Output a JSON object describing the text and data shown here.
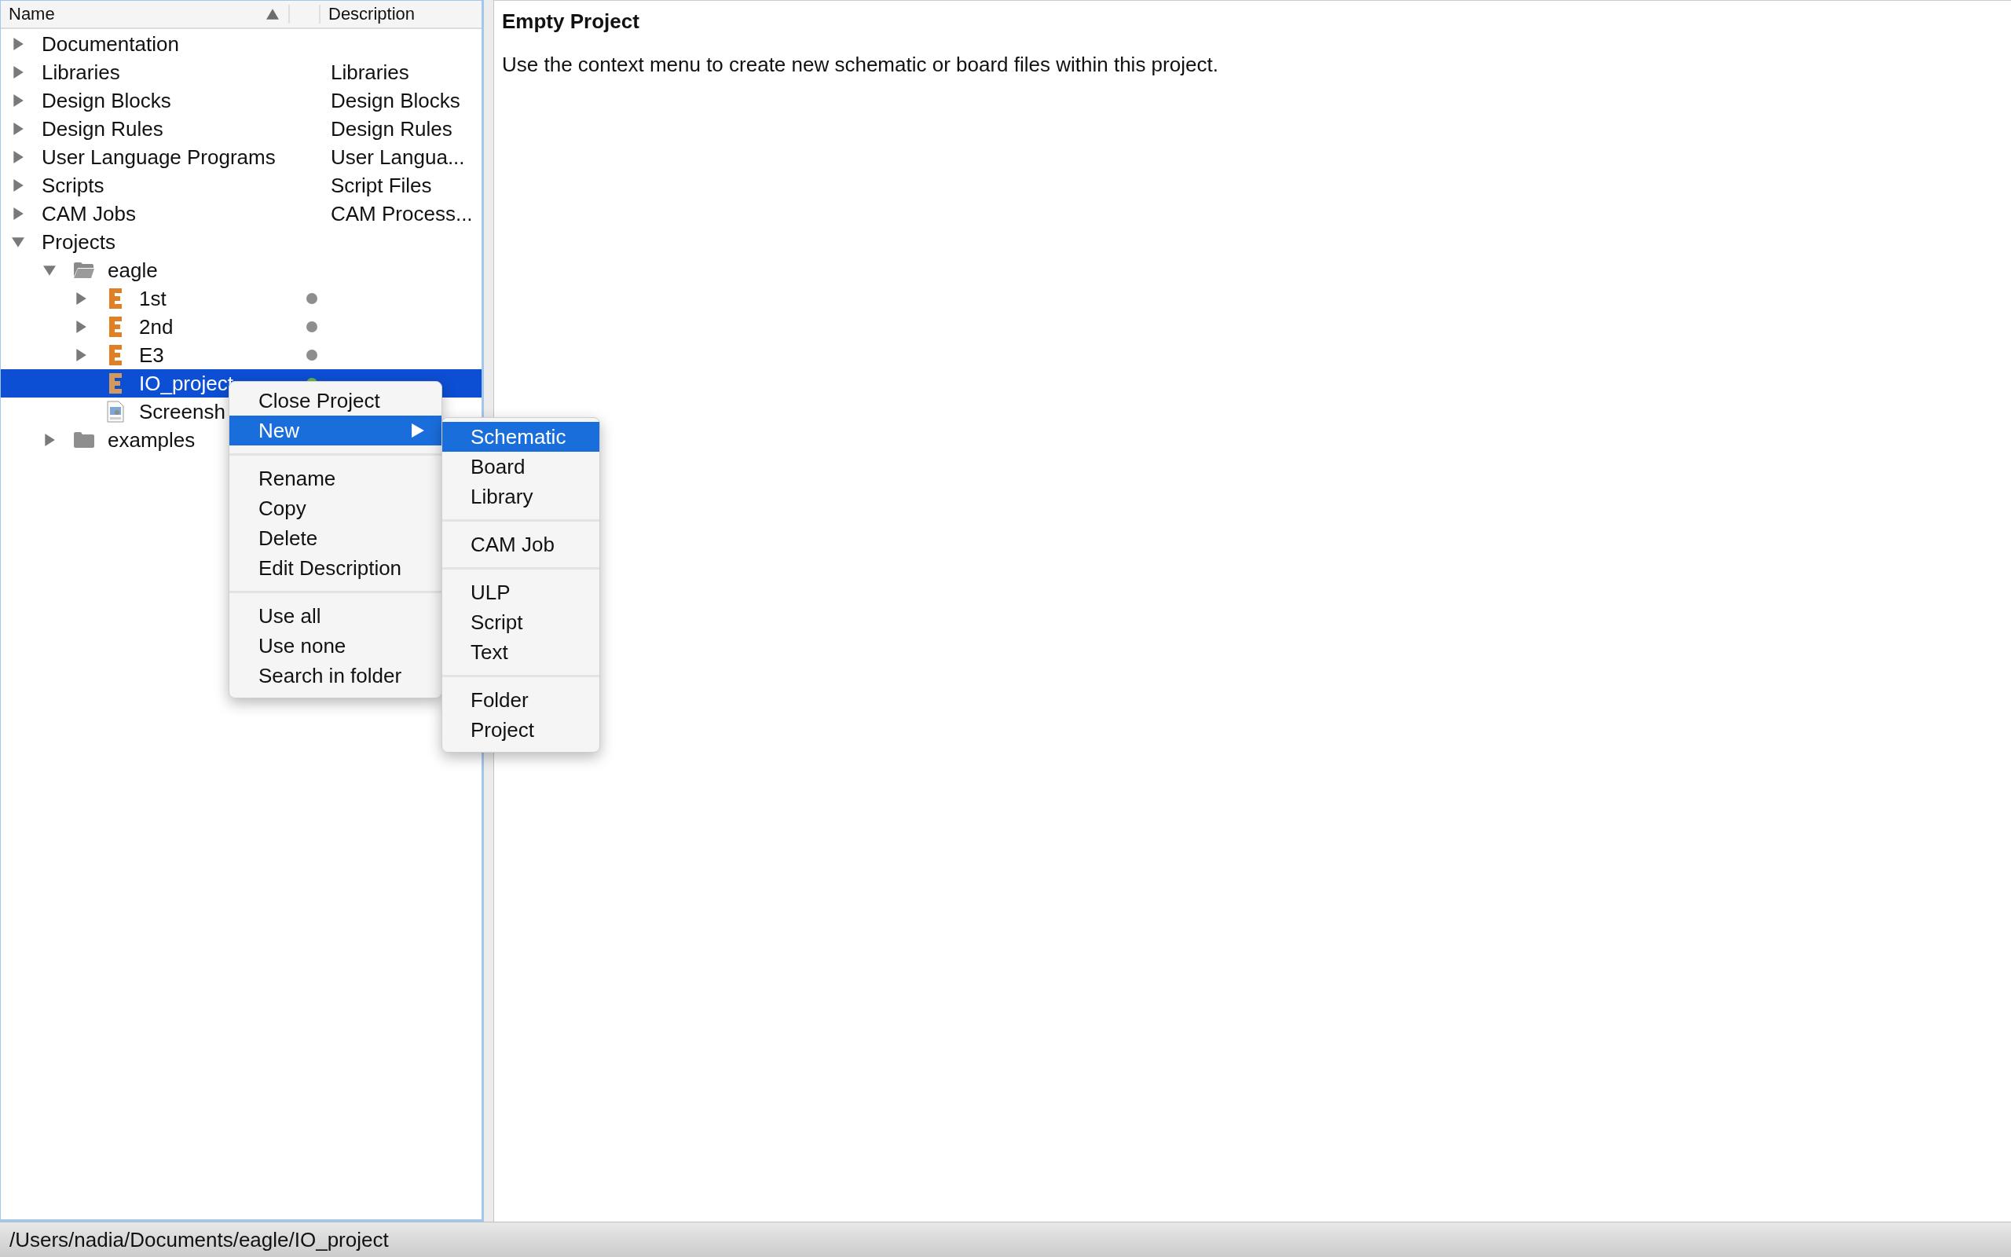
{
  "tree": {
    "columns": [
      {
        "label": "Name",
        "sorted": true
      },
      {
        "label": "Description"
      }
    ],
    "items": [
      {
        "name": "Documentation",
        "expanded": false,
        "selected": false
      },
      {
        "name": "Libraries",
        "description": "Libraries",
        "expanded": false,
        "selected": false
      },
      {
        "name": "Design Blocks",
        "description": "Design Blocks",
        "expanded": false,
        "selected": false
      },
      {
        "name": "Design Rules",
        "description": "Design Rules",
        "expanded": false,
        "selected": false
      },
      {
        "name": "User Language Programs",
        "description": "User Langua...",
        "expanded": false,
        "selected": false
      },
      {
        "name": "Scripts",
        "description": "Script Files",
        "expanded": false,
        "selected": false
      },
      {
        "name": "CAM Jobs",
        "description": "CAM Process...",
        "expanded": false,
        "selected": false
      },
      {
        "name": "Projects",
        "expanded": true,
        "selected": false,
        "children": [
          {
            "name": "eagle",
            "kind": "folder",
            "expanded": true,
            "selected": false,
            "children": [
              {
                "name": "1st",
                "kind": "project",
                "expanded": false,
                "color": "#8e8e8e",
                "selected": false
              },
              {
                "name": "2nd",
                "kind": "project",
                "expanded": false,
                "color": "#8e8e8e",
                "selected": false
              },
              {
                "name": "E3",
                "kind": "project",
                "expanded": false,
                "color": "#8e8e8e",
                "selected": false
              },
              {
                "name": "IO_project",
                "kind": "project",
                "color": "#6ab344",
                "selected": true
              },
              {
                "name": "Screensh",
                "kind": "image",
                "selected": false
              }
            ]
          },
          {
            "name": "examples",
            "kind": "folder",
            "expanded": false,
            "selected": false
          }
        ]
      }
    ]
  },
  "context_menu": {
    "groups": [
      [
        {
          "label": "Close Project",
          "selected": false
        },
        {
          "label": "New",
          "selected": true,
          "has_submenu": true
        }
      ],
      [
        {
          "label": "Rename",
          "selected": false
        },
        {
          "label": "Copy",
          "selected": false
        },
        {
          "label": "Delete",
          "selected": false
        },
        {
          "label": "Edit Description",
          "selected": false
        }
      ],
      [
        {
          "label": "Use all",
          "selected": false
        },
        {
          "label": "Use none",
          "selected": false
        },
        {
          "label": "Search in folder",
          "selected": false
        }
      ]
    ]
  },
  "submenu": {
    "groups": [
      [
        {
          "label": "Schematic",
          "selected": true
        },
        {
          "label": "Board",
          "selected": false
        },
        {
          "label": "Library",
          "selected": false
        }
      ],
      [
        {
          "label": "CAM Job",
          "selected": false
        }
      ],
      [
        {
          "label": "ULP",
          "selected": false
        },
        {
          "label": "Script",
          "selected": false
        },
        {
          "label": "Text",
          "selected": false
        }
      ],
      [
        {
          "label": "Folder",
          "selected": false
        },
        {
          "label": "Project",
          "selected": false
        }
      ]
    ]
  },
  "details": {
    "title": "Empty Project",
    "text": "Use the context menu to create new schematic or board files within this project."
  },
  "status_bar": {
    "path": "/Users/nadia/Documents/eagle/IO_project"
  }
}
